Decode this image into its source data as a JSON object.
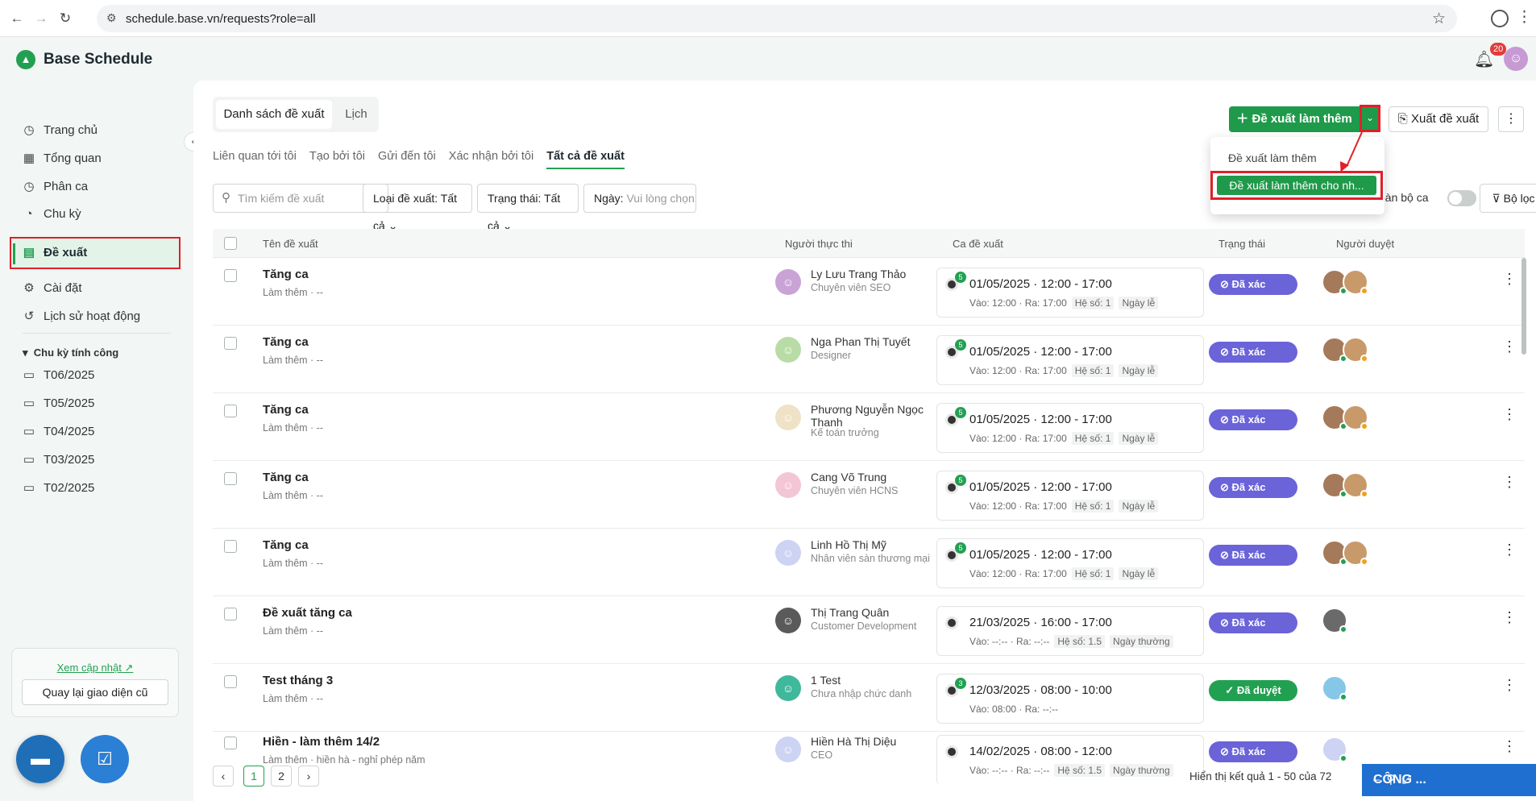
{
  "browser": {
    "url": "schedule.base.vn/requests?role=all"
  },
  "app": {
    "title": "Base Schedule",
    "notif_count": "20"
  },
  "sidebar": {
    "items": [
      {
        "label": "Trang chủ",
        "icon": "clock-icon"
      },
      {
        "label": "Tổng quan",
        "icon": "grid-icon"
      },
      {
        "label": "Phân ca",
        "icon": "clock-icon"
      },
      {
        "label": "Chu kỳ",
        "icon": "cycle-icon"
      },
      {
        "label": "Đề xuất",
        "icon": "doc-icon"
      },
      {
        "label": "Cài đặt",
        "icon": "gear-icon"
      },
      {
        "label": "Lịch sử hoạt động",
        "icon": "history-icon"
      }
    ],
    "section": "Chu kỳ tính công",
    "periods": [
      "T06/2025",
      "T05/2025",
      "T04/2025",
      "T03/2025",
      "T02/2025"
    ],
    "update_link": "Xem cập nhật",
    "old_ui_button": "Quay lại giao diện cũ"
  },
  "main": {
    "view_tabs": [
      "Danh sách đề xuất",
      "Lịch"
    ],
    "sub_tabs": [
      "Liên quan tới tôi",
      "Tạo bởi tôi",
      "Gửi đến tôi",
      "Xác nhận bởi tôi",
      "Tất cả đề xuất"
    ],
    "primary_button": "Đề xuất làm thêm",
    "export_button": "Xuất đề xuất",
    "dropdown": {
      "option1": "Đề xuất làm thêm",
      "option2": "Đề xuất làm thêm cho nh..."
    },
    "search_placeholder": "Tìm kiếm đề xuất",
    "filter_type": "Loại đề xuất: Tất cả",
    "filter_status": "Trạng thái: Tất cả",
    "filter_date_label": "Ngày:",
    "filter_date_placeholder": "Vui lòng chọn",
    "toggle_label": "Toàn bộ ca",
    "filter_button": "Bộ lọc",
    "columns": [
      "Tên đề xuất",
      "Người thực thi",
      "Ca đề xuất",
      "Trạng thái",
      "Người duyệt"
    ],
    "rows": [
      {
        "title": "Tăng ca",
        "sub": "Làm thêm · --",
        "name": "Ly Lưu Trang Thảo",
        "role": "Chuyên viên SEO",
        "num": "5",
        "time": "01/05/2025 · 12:00 - 17:00",
        "inout": "Vào: 12:00 · Ra: 17:00",
        "coef": "Hệ số: 1",
        "day": "Ngày lễ",
        "status": "Đã xác nhận",
        "av_color": "#c9a3d6"
      },
      {
        "title": "Tăng ca",
        "sub": "Làm thêm · --",
        "name": "Nga Phan Thị Tuyết",
        "role": "Designer",
        "num": "5",
        "time": "01/05/2025 · 12:00 - 17:00",
        "inout": "Vào: 12:00 · Ra: 17:00",
        "coef": "Hệ số: 1",
        "day": "Ngày lễ",
        "status": "Đã xác nhận",
        "av_color": "#b9dca6"
      },
      {
        "title": "Tăng ca",
        "sub": "Làm thêm · --",
        "name": "Phương Nguyễn Ngọc Thanh",
        "role": "Kế toán trưởng",
        "num": "5",
        "time": "01/05/2025 · 12:00 - 17:00",
        "inout": "Vào: 12:00 · Ra: 17:00",
        "coef": "Hệ số: 1",
        "day": "Ngày lễ",
        "status": "Đã xác nhận",
        "av_color": "#efe2c6"
      },
      {
        "title": "Tăng ca",
        "sub": "Làm thêm · --",
        "name": "Cang Võ Trung",
        "role": "Chuyên viên HCNS",
        "num": "5",
        "time": "01/05/2025 · 12:00 - 17:00",
        "inout": "Vào: 12:00 · Ra: 17:00",
        "coef": "Hệ số: 1",
        "day": "Ngày lễ",
        "status": "Đã xác nhận",
        "av_color": "#f3c6d6"
      },
      {
        "title": "Tăng ca",
        "sub": "Làm thêm · --",
        "name": "Linh Hồ Thị Mỹ",
        "role": "Nhân viên sàn thương mại",
        "num": "5",
        "time": "01/05/2025 · 12:00 - 17:00",
        "inout": "Vào: 12:00 · Ra: 17:00",
        "coef": "Hệ số: 1",
        "day": "Ngày lễ",
        "status": "Đã xác nhận",
        "av_color": "#cdd3f2"
      },
      {
        "title": "Đề xuất tăng ca",
        "sub": "Làm thêm · --",
        "name": "Thị Trang Quân",
        "role": "Customer Development",
        "num": "",
        "time": "21/03/2025 · 16:00 - 17:00",
        "inout": "Vào: --:-- · Ra: --:--",
        "coef": "Hệ số: 1.5",
        "day": "Ngày thường",
        "status": "Đã xác nhận",
        "av_color": "#5a5a5a"
      },
      {
        "title": "Test tháng 3",
        "sub": "Làm thêm · --",
        "name": "1 Test",
        "role": "Chưa nhập chức danh",
        "num": "3",
        "time": "12/03/2025 · 08:00 - 10:00",
        "inout": "Vào: 08:00 · Ra: --:--",
        "coef": "",
        "day": "",
        "status": "Đã duyệt",
        "av_color": "#3fb89c"
      },
      {
        "title": "Hiền - làm thêm 14/2",
        "sub": "Làm thêm · hiền hà - nghỉ phép năm",
        "name": "Hiền Hà Thị Diệu",
        "role": "CEO",
        "num": "",
        "time": "14/02/2025 · 08:00 - 12:00",
        "inout": "Vào: --:-- · Ra: --:--",
        "coef": "Hệ số: 1.5",
        "day": "Ngày thường",
        "status": "Đã xác nhận",
        "av_color": "#cdd3f2"
      }
    ],
    "pages": [
      "1",
      "2"
    ],
    "result_text": "Hiển thị kết quả 1 - 50 của 72"
  },
  "widget": {
    "label": "CÔNG ..."
  }
}
